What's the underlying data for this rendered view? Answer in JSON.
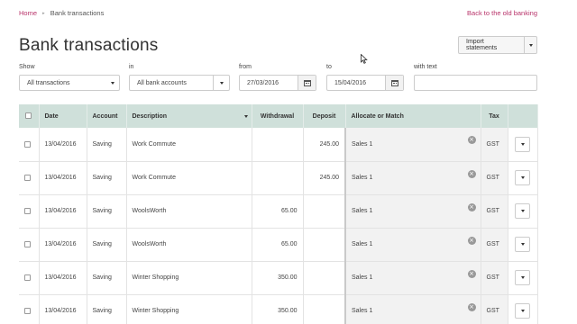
{
  "breadcrumb": {
    "home": "Home",
    "separator": "▸",
    "current": "Bank transactions"
  },
  "back_link": "Back to the old banking",
  "page_title": "Bank transactions",
  "import_button": "Import statements",
  "filters": {
    "show": {
      "label": "Show",
      "value": "All transactions"
    },
    "in": {
      "label": "in",
      "value": "All bank accounts"
    },
    "from": {
      "label": "from",
      "value": "27/03/2016"
    },
    "to": {
      "label": "to",
      "value": "15/04/2016"
    },
    "text": {
      "label": "with text",
      "value": ""
    }
  },
  "table": {
    "headers": {
      "date": "Date",
      "account": "Account",
      "description": "Description",
      "withdrawal": "Withdrawal",
      "deposit": "Deposit",
      "allocate": "Allocate or Match",
      "tax": "Tax"
    },
    "rows": [
      {
        "date": "13/04/2016",
        "account": "Saving",
        "description": "Work Commute",
        "withdrawal": "",
        "deposit": "245.00",
        "allocate": "Sales 1",
        "tax": "GST"
      },
      {
        "date": "13/04/2016",
        "account": "Saving",
        "description": "Work Commute",
        "withdrawal": "",
        "deposit": "245.00",
        "allocate": "Sales 1",
        "tax": "GST"
      },
      {
        "date": "13/04/2016",
        "account": "Saving",
        "description": "WoolsWorth",
        "withdrawal": "65.00",
        "deposit": "",
        "allocate": "Sales 1",
        "tax": "GST"
      },
      {
        "date": "13/04/2016",
        "account": "Saving",
        "description": "WoolsWorth",
        "withdrawal": "65.00",
        "deposit": "",
        "allocate": "Sales 1",
        "tax": "GST"
      },
      {
        "date": "13/04/2016",
        "account": "Saving",
        "description": "Winter Shopping",
        "withdrawal": "350.00",
        "deposit": "",
        "allocate": "Sales 1",
        "tax": "GST"
      },
      {
        "date": "13/04/2016",
        "account": "Saving",
        "description": "Winter Shopping",
        "withdrawal": "350.00",
        "deposit": "",
        "allocate": "Sales 1",
        "tax": "GST"
      }
    ]
  },
  "colors": {
    "link": "#b8336a",
    "table_header": "#cfe0da"
  }
}
